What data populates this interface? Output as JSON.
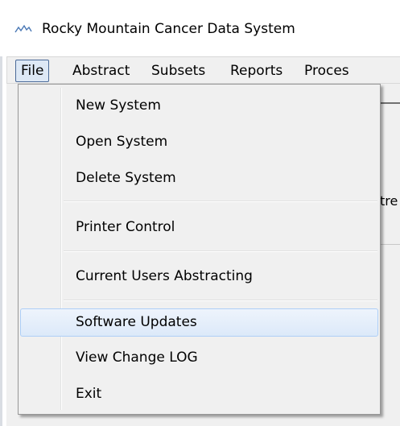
{
  "window": {
    "title": "Rocky Mountain Cancer Data System"
  },
  "menubar": {
    "items": [
      "File",
      "Abstract",
      "Subsets",
      "Reports",
      "Proces"
    ]
  },
  "file_menu": {
    "items": [
      "New System",
      "Open System",
      "Delete System",
      "Printer Control",
      "Current Users Abstracting",
      "Software Updates",
      "View Change LOG",
      "Exit"
    ],
    "highlighted": "Software Updates"
  },
  "background": {
    "text_fragment": "tre"
  },
  "colors": {
    "menu_bg": "#f0f0f0",
    "active_menu_bg": "#dde8f5",
    "active_menu_border": "#4a6a98",
    "hover_bg": "#dce9f9",
    "hover_border": "#aecff7"
  }
}
